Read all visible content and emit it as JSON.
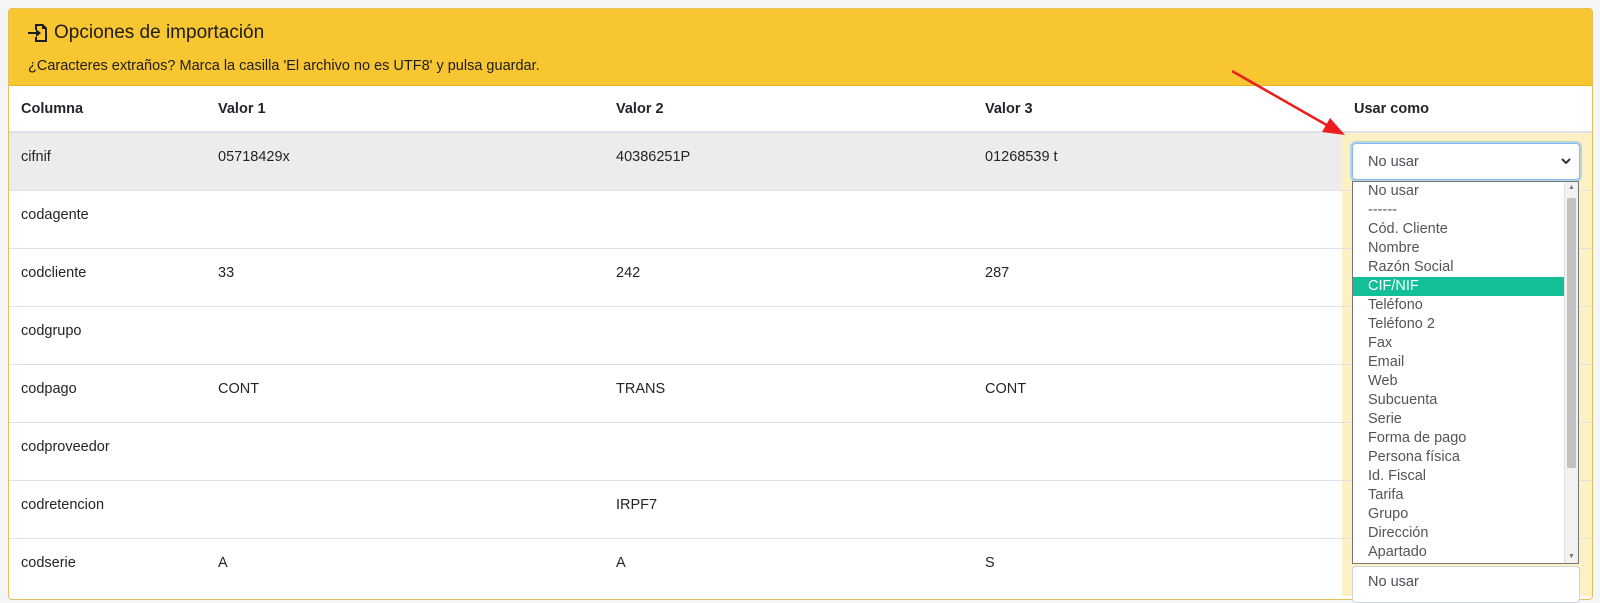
{
  "header": {
    "title": "Opciones de importación",
    "subtitle": "¿Caracteres extraños? Marca la casilla 'El archivo no es UTF8' y pulsa guardar."
  },
  "table": {
    "columns": [
      "Columna",
      "Valor 1",
      "Valor 2",
      "Valor 3",
      "Usar como"
    ],
    "rows": [
      {
        "name": "cifnif",
        "v1": "05718429x",
        "v2": "40386251P",
        "v3": "01268539 t"
      },
      {
        "name": "codagente",
        "v1": "",
        "v2": "",
        "v3": ""
      },
      {
        "name": "codcliente",
        "v1": "33",
        "v2": "242",
        "v3": "287"
      },
      {
        "name": "codgrupo",
        "v1": "",
        "v2": "",
        "v3": ""
      },
      {
        "name": "codpago",
        "v1": "CONT",
        "v2": "TRANS",
        "v3": "CONT"
      },
      {
        "name": "codproveedor",
        "v1": "",
        "v2": "",
        "v3": ""
      },
      {
        "name": "codretencion",
        "v1": "",
        "v2": "IRPF7",
        "v3": ""
      },
      {
        "name": "codserie",
        "v1": "A",
        "v2": "A",
        "v3": "S"
      }
    ]
  },
  "select": {
    "value": "No usar",
    "last_row_value": "No usar",
    "options": [
      "No usar",
      "------",
      "Cód. Cliente",
      "Nombre",
      "Razón Social",
      "CIF/NIF",
      "Teléfono",
      "Teléfono 2",
      "Fax",
      "Email",
      "Web",
      "Subcuenta",
      "Serie",
      "Forma de pago",
      "Persona física",
      "Id. Fiscal",
      "Tarifa",
      "Grupo",
      "Dirección",
      "Apartado"
    ],
    "highlighted": "CIF/NIF"
  },
  "colors": {
    "header_bg": "#f8c630",
    "highlight": "#13bf96",
    "arrow": "#ee1c1c"
  }
}
